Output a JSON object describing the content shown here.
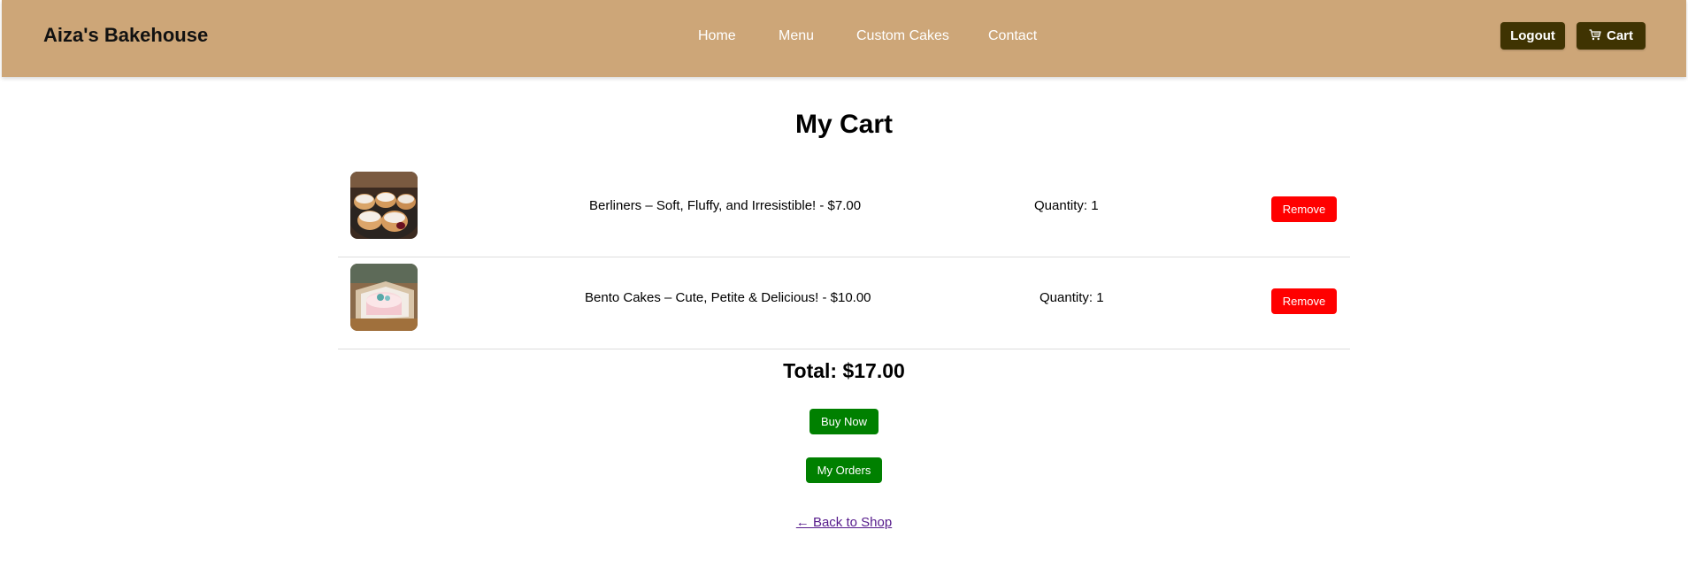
{
  "header": {
    "brand": "Aiza's Bakehouse",
    "nav": {
      "home": "Home",
      "menu": "Menu",
      "custom_cakes": "Custom Cakes",
      "contact": "Contact"
    },
    "logout_label": "Logout",
    "cart_label": "Cart",
    "cart_icon": "cart-icon"
  },
  "page": {
    "title": "My Cart"
  },
  "cart": {
    "items": [
      {
        "name_price": "Berliners – Soft, Fluffy, and Irresistible! - $7.00",
        "quantity": "Quantity: 1",
        "remove_label": "Remove",
        "image": "berliners-photo"
      },
      {
        "name_price": "Bento Cakes – Cute, Petite & Delicious! - $10.00",
        "quantity": "Quantity: 1",
        "remove_label": "Remove",
        "image": "bento-cake-photo"
      }
    ],
    "total": "Total: $17.00",
    "buy_now_label": "Buy Now",
    "my_orders_label": "My Orders",
    "back_link": "← Back to Shop"
  },
  "colors": {
    "navbar": "#cda678",
    "dark_button": "#3f3302",
    "remove_button": "#ff0000",
    "action_button": "#008000",
    "link": "#551a8b"
  }
}
